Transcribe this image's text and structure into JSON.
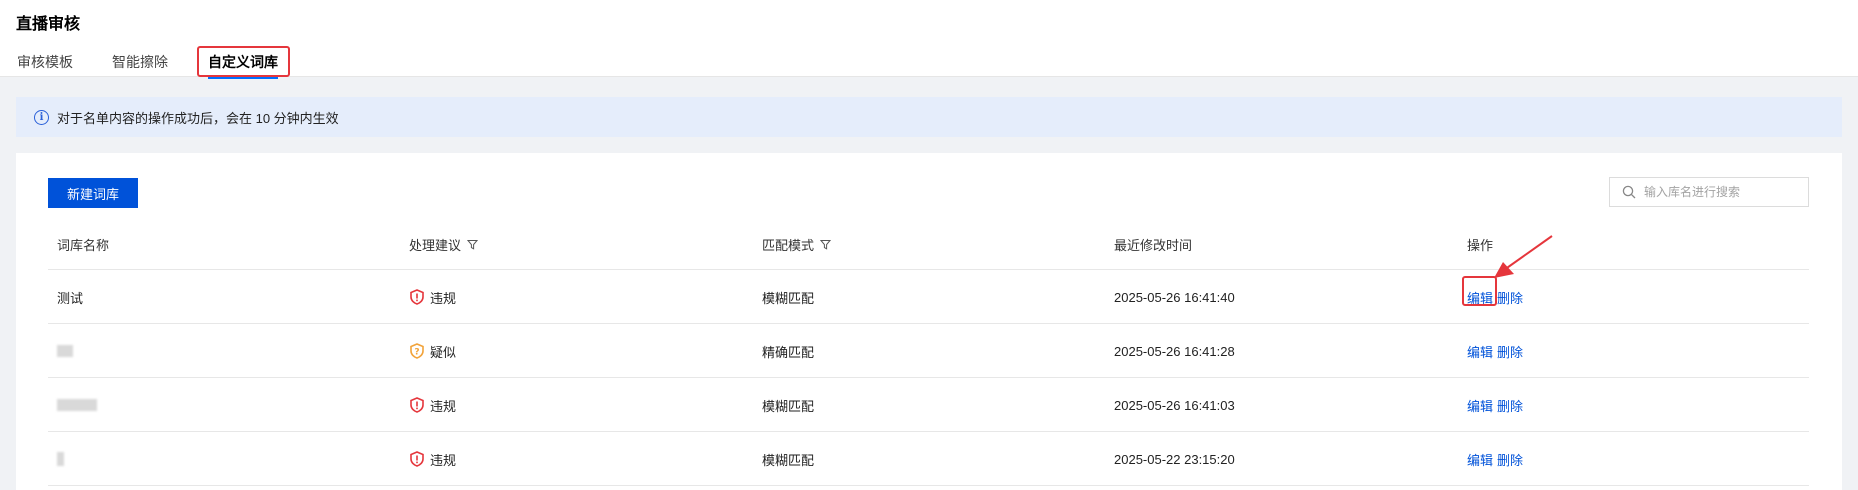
{
  "page": {
    "title": "直播审核"
  },
  "tabs": [
    {
      "label": "审核模板"
    },
    {
      "label": "智能擦除"
    },
    {
      "label": "自定义词库"
    }
  ],
  "notice": {
    "text": "对于名单内容的操作成功后，会在 10 分钟内生效"
  },
  "toolbar": {
    "new_button": "新建词库",
    "search_placeholder": "输入库名进行搜索"
  },
  "table": {
    "headers": [
      "词库名称",
      "处理建议",
      "匹配模式",
      "最近修改时间",
      "操作"
    ],
    "rows": [
      {
        "name": "测试",
        "suggestion": "违规",
        "mode": "模糊匹配",
        "time": "2025-05-26 16:41:40",
        "edit": "编辑",
        "delete": "删除"
      },
      {
        "name": "",
        "suggestion": "疑似",
        "mode": "精确匹配",
        "time": "2025-05-26 16:41:28",
        "edit": "编辑",
        "delete": "删除"
      },
      {
        "name": "",
        "suggestion": "违规",
        "mode": "模糊匹配",
        "time": "2025-05-26 16:41:03",
        "edit": "编辑",
        "delete": "删除"
      },
      {
        "name": "",
        "suggestion": "违规",
        "mode": "模糊匹配",
        "time": "2025-05-22 23:15:20",
        "edit": "编辑",
        "delete": "删除"
      }
    ]
  },
  "colors": {
    "primary": "#0052d9",
    "violation": "#e5363c",
    "suspect": "#f2a33a",
    "annotation": "#e5363c"
  }
}
